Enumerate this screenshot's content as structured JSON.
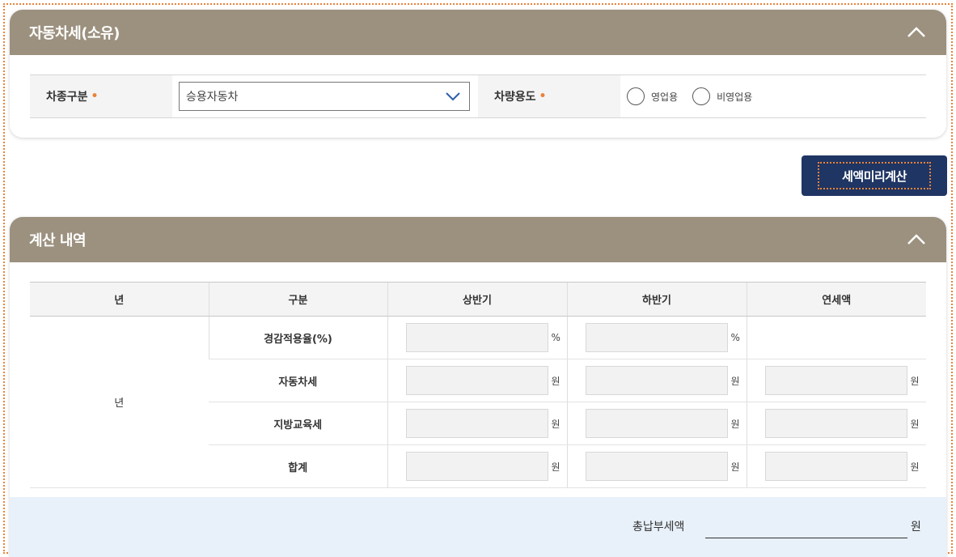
{
  "section1": {
    "title": "자동차세(소유)",
    "vehicle_type_label": "차종구분",
    "vehicle_type_value": "승용자동차",
    "vehicle_use_label": "차량용도",
    "use_options": [
      "영업용",
      "비영업용"
    ],
    "required_mark": "•"
  },
  "calc_button": "세액미리계산",
  "section2": {
    "title": "계산 내역",
    "headers": [
      "년",
      "구분",
      "상반기",
      "하반기",
      "연세액"
    ],
    "year_cell": "년",
    "rows": [
      {
        "label": "경감적용율(%)",
        "unit": "%"
      },
      {
        "label": "자동차세",
        "unit": "원"
      },
      {
        "label": "지방교육세",
        "unit": "원"
      },
      {
        "label": "합계",
        "unit": "원"
      }
    ],
    "total_label": "총납부세액",
    "total_unit": "원"
  },
  "colors": {
    "header": "#9c917f",
    "button": "#1f3563",
    "accent": "#e8833a",
    "total_bg": "#e8f1fa"
  }
}
